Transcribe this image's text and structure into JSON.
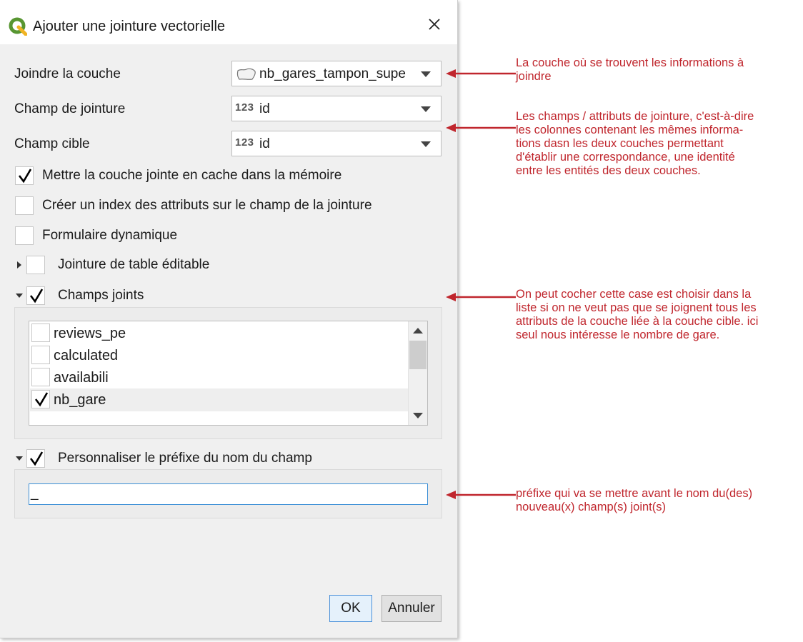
{
  "dialog": {
    "title": "Ajouter une jointure vectorielle",
    "icons": {
      "app": "qgis-icon",
      "close": "close-icon"
    }
  },
  "form": {
    "join_layer_label": "Joindre la couche",
    "join_layer_value": "nb_gares_tampon_supe",
    "join_field_label": "Champ de jointure",
    "join_field_value": "id",
    "target_field_label": "Champ cible",
    "target_field_value": "id",
    "numeric_field_icon_text": "123"
  },
  "options": {
    "cache": {
      "label": "Mettre la couche jointe en cache dans la mémoire",
      "checked": true
    },
    "index": {
      "label": "Créer un index des attributs sur le champ de la jointure",
      "checked": false
    },
    "dynamic_form": {
      "label": "Formulaire dynamique",
      "checked": false
    },
    "editable": {
      "label": "Jointure de table éditable",
      "checked": false
    },
    "joined_fields": {
      "label": "Champs joints",
      "checked": true
    },
    "custom_prefix": {
      "label": "Personnaliser le préfixe du nom du champ",
      "checked": true
    }
  },
  "fields_list": [
    {
      "name": "reviews_pe",
      "checked": false
    },
    {
      "name": "calculated",
      "checked": false
    },
    {
      "name": "availabili",
      "checked": false
    },
    {
      "name": "nb_gare",
      "checked": true
    }
  ],
  "prefix_value": "_",
  "buttons": {
    "ok": "OK",
    "cancel": "Annuler"
  },
  "annotations": {
    "color": "#c0262d",
    "layer": "La couche où se trouvent les informations à\njoindre",
    "fields": "Les champs / attributs de jointure, c'est-à-dire\nles colonnes contenant les mêmes informa-\ntions dasn les deux couches permettant\nd'établir une correspondance, une identité\nentre les entités des deux couches.",
    "joined": "On peut cocher cette case est choisir dans la\nliste si on ne veut pas que se joignent tous les\nattributs de la couche liée à la couche cible. ici\nseul nous intéresse le nombre de gare.",
    "prefix": "préfixe qui va se mettre avant le nom du(des)\nnouveau(x) champ(s) joint(s)"
  }
}
